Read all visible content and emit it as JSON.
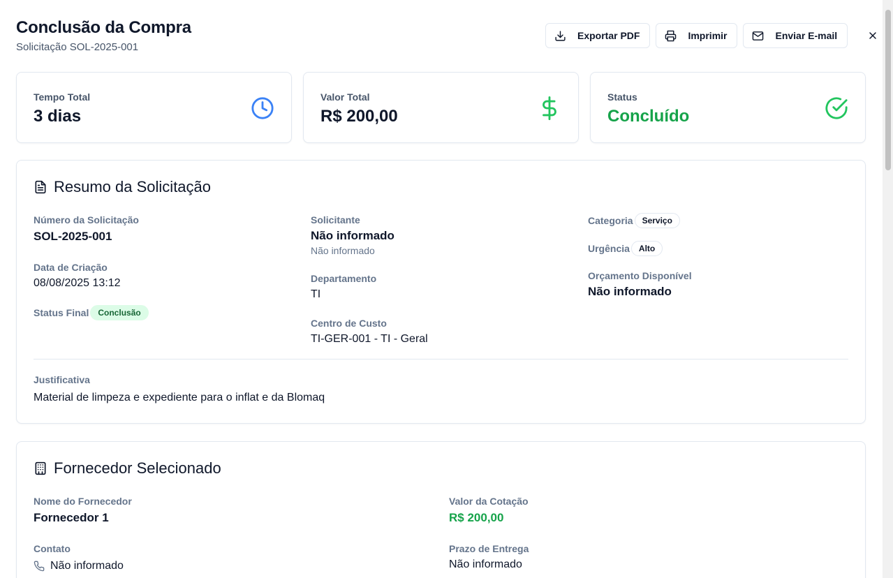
{
  "header": {
    "title": "Conclusão da Compra",
    "subtitle": "Solicitação SOL-2025-001"
  },
  "actions": {
    "export_label": "Exportar PDF",
    "print_label": "Imprimir",
    "email_label": "Enviar E-mail"
  },
  "stats": [
    {
      "label": "Tempo Total",
      "value": "3 dias",
      "icon": "clock-icon",
      "color": "#3b82f6"
    },
    {
      "label": "Valor Total",
      "value": "R$ 200,00",
      "icon": "dollar-icon",
      "color": "#22c55e"
    },
    {
      "label": "Status",
      "value": "Concluído",
      "icon": "check-circle-icon",
      "color": "#16a34a"
    }
  ],
  "summary": {
    "title": "Resumo da Solicitação",
    "numero_label": "Número da Solicitação",
    "numero_value": "SOL-2025-001",
    "data_label": "Data de Criação",
    "data_value": "08/08/2025 13:12",
    "status_label": "Status Final",
    "status_badge": "Conclusão",
    "solicitante_label": "Solicitante",
    "solicitante_value": "Não informado",
    "solicitante_sub": "Não informado",
    "departamento_label": "Departamento",
    "departamento_value": "TI",
    "centro_label": "Centro de Custo",
    "centro_value": "TI-GER-001 - TI - Geral",
    "categoria_label": "Categoria",
    "categoria_badge": "Serviço",
    "urgencia_label": "Urgência",
    "urgencia_badge": "Alto",
    "orcamento_label": "Orçamento Disponível",
    "orcamento_value": "Não informado",
    "justificativa_label": "Justificativa",
    "justificativa_value": "Material de limpeza e expediente para o inflat e da Blomaq"
  },
  "supplier": {
    "title": "Fornecedor Selecionado",
    "nome_label": "Nome do Fornecedor",
    "nome_value": "Fornecedor 1",
    "contato_label": "Contato",
    "contato_value": "Não informado",
    "valor_label": "Valor da Cotação",
    "valor_value": "R$ 200,00",
    "prazo_label": "Prazo de Entrega",
    "prazo_value": "Não informado"
  }
}
